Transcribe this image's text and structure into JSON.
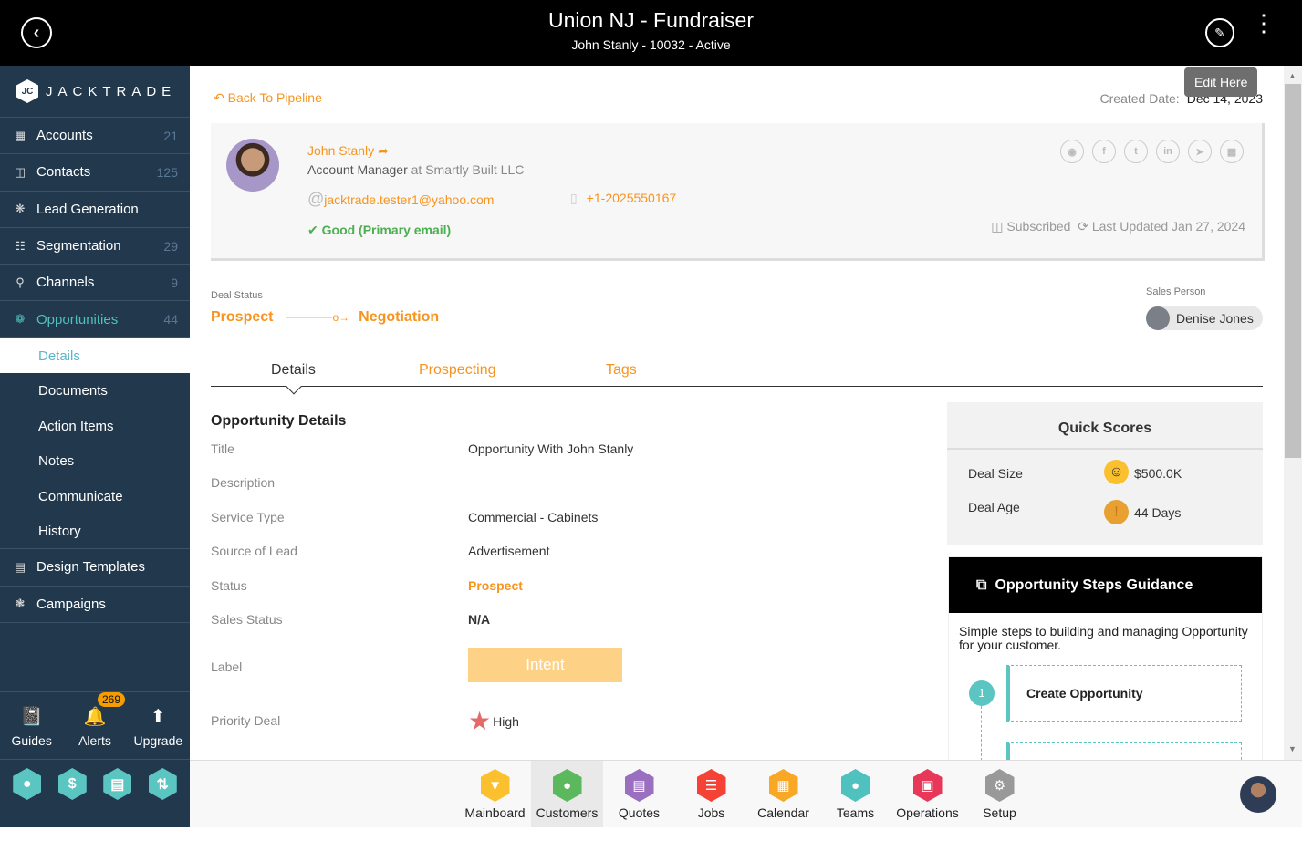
{
  "header": {
    "title": "Union NJ - Fundraiser",
    "subtitle": "John Stanly - 10032 - Active",
    "back_icon": "chevron-left-icon",
    "edit_icon": "pencil-icon",
    "menu_icon": "kebab-icon"
  },
  "sidebar": {
    "logo": "JACKTRADE",
    "items": [
      {
        "label": "Accounts",
        "count": "21",
        "icon": "building-icon"
      },
      {
        "label": "Contacts",
        "count": "125",
        "icon": "contacts-icon"
      },
      {
        "label": "Lead Generation",
        "count": "",
        "icon": "lead-icon"
      },
      {
        "label": "Segmentation",
        "count": "29",
        "icon": "segmentation-icon"
      },
      {
        "label": "Channels",
        "count": "9",
        "icon": "channels-icon"
      },
      {
        "label": "Opportunities",
        "count": "44",
        "icon": "opportunities-icon"
      }
    ],
    "subitems": [
      "Details",
      "Documents",
      "Action Items",
      "Notes",
      "Communicate",
      "History"
    ],
    "items2": [
      {
        "label": "Design Templates",
        "icon": "templates-icon"
      },
      {
        "label": "Campaigns",
        "icon": "campaigns-icon"
      }
    ],
    "bottom": [
      {
        "label": "Guides"
      },
      {
        "label": "Alerts",
        "badge": "269"
      },
      {
        "label": "Upgrade"
      }
    ],
    "accent": "#4fc1be"
  },
  "main": {
    "back_link": "Back To Pipeline",
    "created_label": "Created Date:",
    "created_value": "Dec 14, 2023",
    "tooltip": "Edit Here",
    "contact": {
      "name": "John Stanly",
      "role": "Account Manager",
      "at": "at Smartly Built LLC",
      "email": "jacktrade.tester1@yahoo.com",
      "phone": "+1-2025550167",
      "email_status": "Good (Primary email)",
      "subscribed": "Subscribed",
      "last_updated": "Last Updated Jan 27, 2024",
      "socials": [
        "instagram",
        "facebook",
        "twitter",
        "linkedin",
        "telegram",
        "more"
      ]
    },
    "deal_status_label": "Deal Status",
    "deal_from": "Prospect",
    "deal_to": "Negotiation",
    "sales_person_label": "Sales Person",
    "sales_person": "Denise Jones",
    "tabs": [
      "Details",
      "Prospecting",
      "Tags"
    ],
    "details_title": "Opportunity Details",
    "fields": [
      {
        "label": "Title",
        "value": "Opportunity With John Stanly"
      },
      {
        "label": "Description",
        "value": ""
      },
      {
        "label": "Service Type",
        "value": "Commercial - Cabinets"
      },
      {
        "label": "Source of Lead",
        "value": "Advertisement"
      },
      {
        "label": "Status",
        "value": "Prospect"
      },
      {
        "label": "Sales Status",
        "value": "N/A"
      },
      {
        "label": "Label",
        "value": "Intent"
      },
      {
        "label": "Priority Deal",
        "value": "High"
      }
    ],
    "quick_scores": {
      "title": "Quick Scores",
      "deal_size_label": "Deal Size",
      "deal_size": "$500.0K",
      "deal_age_label": "Deal Age",
      "deal_age": "44 Days"
    },
    "guidance": {
      "title": "Opportunity Steps Guidance",
      "text": "Simple steps to building and managing Opportunity for your customer.",
      "steps": [
        {
          "num": "1",
          "label": "Create Opportunity"
        }
      ]
    }
  },
  "apps": [
    {
      "label": "Mainboard",
      "color": "#fbc02d"
    },
    {
      "label": "Customers",
      "color": "#5cb85c"
    },
    {
      "label": "Quotes",
      "color": "#9b6fc0"
    },
    {
      "label": "Jobs",
      "color": "#f44336"
    },
    {
      "label": "Calendar",
      "color": "#f9a825"
    },
    {
      "label": "Teams",
      "color": "#4fc1be"
    },
    {
      "label": "Operations",
      "color": "#e8385a"
    },
    {
      "label": "Setup",
      "color": "#999999"
    }
  ]
}
